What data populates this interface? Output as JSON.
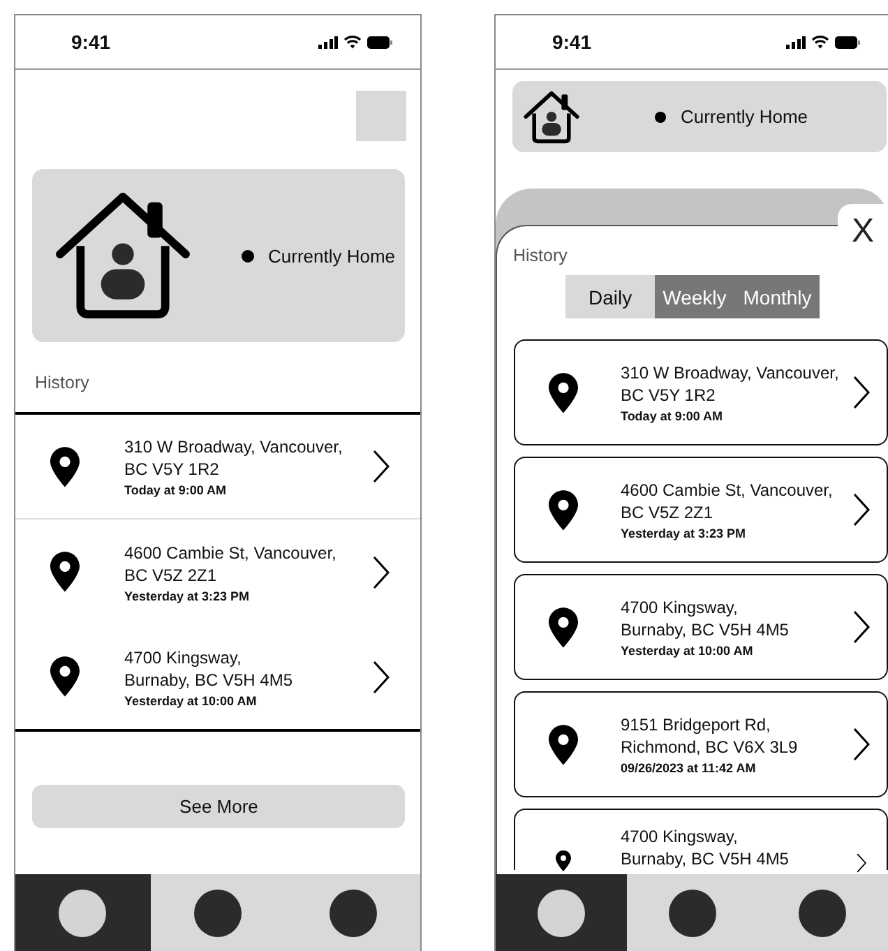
{
  "home_screen": {
    "status_bar": {
      "time": "9:41"
    },
    "status_card": {
      "status": "Currently Home"
    },
    "history_title": "History",
    "history": [
      {
        "address_lines": [
          "310 W Broadway, Vancouver,",
          "BC V5Y 1R2"
        ],
        "time": "Today at 9:00 AM"
      },
      {
        "address_lines": [
          "4600 Cambie St, Vancouver,",
          "BC V5Z 2Z1"
        ],
        "time": "Yesterday at 3:23 PM"
      },
      {
        "address_lines": [
          "4700 Kingsway,",
          "Burnaby, BC V5H 4M5"
        ],
        "time": "Yesterday at 10:00 AM"
      }
    ],
    "see_more": "See More",
    "nav": [
      {
        "selected": true
      },
      {
        "selected": false
      },
      {
        "selected": false
      }
    ]
  },
  "history_screen": {
    "status_bar": {
      "time": "9:41"
    },
    "status_card": {
      "status": "Currently Home"
    },
    "close": "X",
    "history_title": "History",
    "tabs": [
      {
        "label": "Daily",
        "selected": true
      },
      {
        "label": "Weekly",
        "selected": false
      },
      {
        "label": "Monthly",
        "selected": false
      }
    ],
    "history": [
      {
        "address_lines": [
          "310 W Broadway, Vancouver,",
          "BC V5Y 1R2"
        ],
        "time": "Today at 9:00 AM"
      },
      {
        "address_lines": [
          "4600 Cambie St, Vancouver,",
          "BC V5Z 2Z1"
        ],
        "time": "Yesterday at 3:23 PM"
      },
      {
        "address_lines": [
          "4700 Kingsway,",
          "Burnaby, BC V5H 4M5"
        ],
        "time": "Yesterday at 10:00 AM"
      },
      {
        "address_lines": [
          "9151 Bridgeport Rd,",
          "Richmond, BC V6X 3L9"
        ],
        "time": "09/26/2023 at 11:42 AM"
      },
      {
        "address_lines": [
          "4700 Kingsway,",
          "Burnaby, BC V5H 4M5"
        ]
      }
    ],
    "nav": [
      {
        "selected": true
      },
      {
        "selected": false
      },
      {
        "selected": false
      }
    ]
  }
}
